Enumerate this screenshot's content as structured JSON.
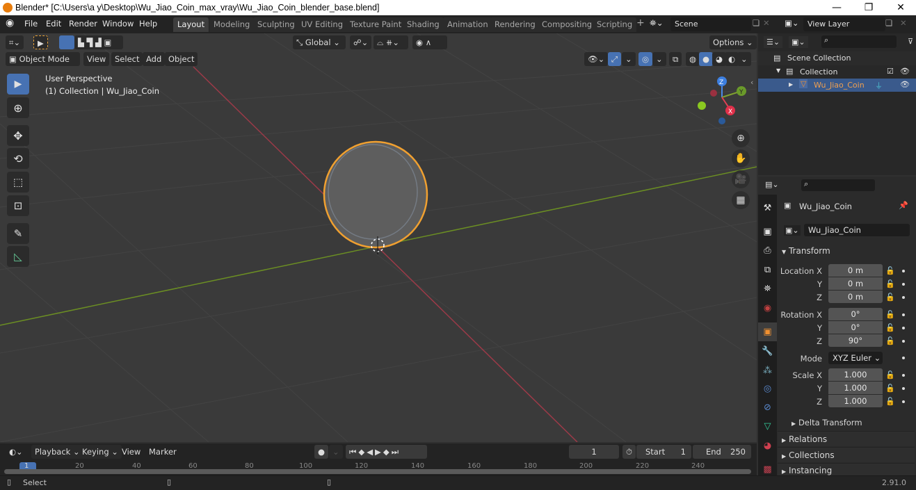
{
  "window": {
    "title": "Blender* [C:\\Users\\a y\\Desktop\\Wu_Jiao_Coin_max_vray\\Wu_Jiao_Coin_blender_base.blend]",
    "minimize": "—",
    "maximize": "❐",
    "close": "✕"
  },
  "topbar": {
    "menus": [
      "File",
      "Edit",
      "Render",
      "Window",
      "Help"
    ],
    "workspaces": [
      "Layout",
      "Modeling",
      "Sculpting",
      "UV Editing",
      "Texture Paint",
      "Shading",
      "Animation",
      "Rendering",
      "Compositing",
      "Scripting"
    ],
    "active_workspace": "Layout",
    "add_workspace": "+",
    "scene": "Scene",
    "view_layer": "View Layer"
  },
  "viewport": {
    "transform_orientation": "Global",
    "options": "Options",
    "mode": "Object Mode",
    "menus": [
      "View",
      "Select",
      "Add",
      "Object"
    ],
    "overlay_title": "User Perspective",
    "overlay_subtitle": "(1) Collection | Wu_Jiao_Coin",
    "gizmo": {
      "z": "Z",
      "y": "Y",
      "x": "X"
    },
    "colors": {
      "x_axis": "#9c3a48",
      "y_axis": "#6b8e23",
      "selection": "#f0a030",
      "active_tool": "#4772b3"
    }
  },
  "outliner": {
    "scene_collection": "Scene Collection",
    "collection": "Collection",
    "object": "Wu_Jiao_Coin"
  },
  "properties": {
    "object_name": "Wu_Jiao_Coin",
    "object_field": "Wu_Jiao_Coin",
    "transform_label": "Transform",
    "location": {
      "label": "Location X",
      "x": "0 m",
      "y": "0 m",
      "z": "0 m"
    },
    "rotation": {
      "label": "Rotation X",
      "x": "0°",
      "y": "0°",
      "z": "90°"
    },
    "mode_label": "Mode",
    "mode_value": "XYZ Euler",
    "scale": {
      "label": "Scale X",
      "x": "1.000",
      "y": "1.000",
      "z": "1.000"
    },
    "axis_y": "Y",
    "axis_z": "Z",
    "delta_transform": "Delta Transform",
    "relations": "Relations",
    "collections": "Collections",
    "instancing": "Instancing"
  },
  "timeline": {
    "menus": [
      "Playback",
      "Keying",
      "View",
      "Marker"
    ],
    "current_frame": "1",
    "start_label": "Start",
    "start": "1",
    "end_label": "End",
    "end": "250",
    "ticks": [
      "1",
      "20",
      "40",
      "60",
      "80",
      "100",
      "120",
      "140",
      "160",
      "180",
      "200",
      "220",
      "240"
    ]
  },
  "statusbar": {
    "select": "Select",
    "version": "2.91.0"
  }
}
